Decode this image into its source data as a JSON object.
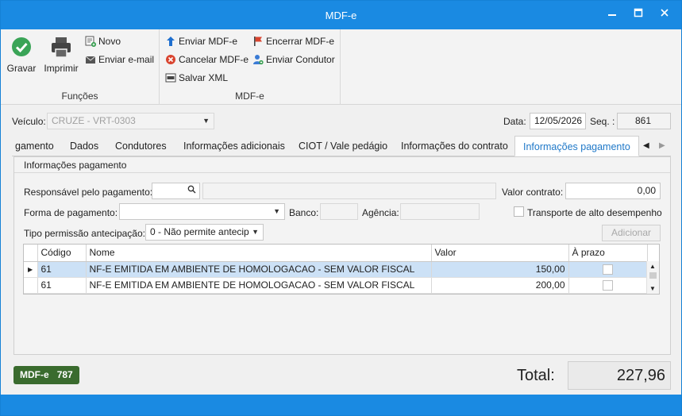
{
  "window": {
    "title": "MDF-e"
  },
  "ribbon": {
    "funcoes": {
      "label": "Funções",
      "gravar": "Gravar",
      "imprimir": "Imprimir",
      "novo": "Novo",
      "enviar_email": "Enviar e-mail"
    },
    "mdfe": {
      "label": "MDF-e",
      "enviar": "Enviar MDF-e",
      "cancelar": "Cancelar MDF-e",
      "salvar_xml": "Salvar XML",
      "encerrar": "Encerrar MDF-e",
      "enviar_condutor": "Enviar Condutor"
    }
  },
  "header": {
    "veiculo_label": "Veículo:",
    "veiculo_value": "CRUZE - VRT-0303",
    "data_label": "Data:",
    "data_value": "12/05/2026",
    "seq_label": "Seq. :",
    "seq_value": "861"
  },
  "tabs": [
    {
      "label": "gamento"
    },
    {
      "label": "Dados"
    },
    {
      "label": "Condutores"
    },
    {
      "label": "Informações adicionais"
    },
    {
      "label": "CIOT / Vale pedágio"
    },
    {
      "label": "Informações do contrato"
    },
    {
      "label": "Informações pagamento"
    }
  ],
  "pagamento": {
    "section_title": "Informações pagamento",
    "responsavel_label": "Responsável pelo pagamento:",
    "responsavel_value": "",
    "valor_contrato_label": "Valor contrato:",
    "valor_contrato_value": "0,00",
    "forma_label": "Forma de pagamento:",
    "forma_value": "",
    "banco_label": "Banco:",
    "agencia_label": "Agência:",
    "transporte_label": "Transporte de alto desempenho",
    "tipo_label": "Tipo permissão antecipação:",
    "tipo_value": "0 - Não permite antecip",
    "adicionar": "Adicionar"
  },
  "grid": {
    "columns": [
      "Código",
      "Nome",
      "Valor",
      "À prazo"
    ],
    "rows": [
      {
        "codigo": "61",
        "nome": "NF-E EMITIDA EM AMBIENTE DE HOMOLOGACAO - SEM VALOR FISCAL",
        "valor": "150,00"
      },
      {
        "codigo": "61",
        "nome": "NF-E EMITIDA EM AMBIENTE DE HOMOLOGACAO - SEM VALOR FISCAL",
        "valor": "200,00"
      }
    ]
  },
  "footer": {
    "badge_label": "MDF-e",
    "badge_number": "787",
    "total_label": "Total:",
    "total_value": "227,96"
  },
  "colors": {
    "accent": "#1a8ae2",
    "badge": "#3a6b2e",
    "selected_row": "#cce1f6"
  }
}
